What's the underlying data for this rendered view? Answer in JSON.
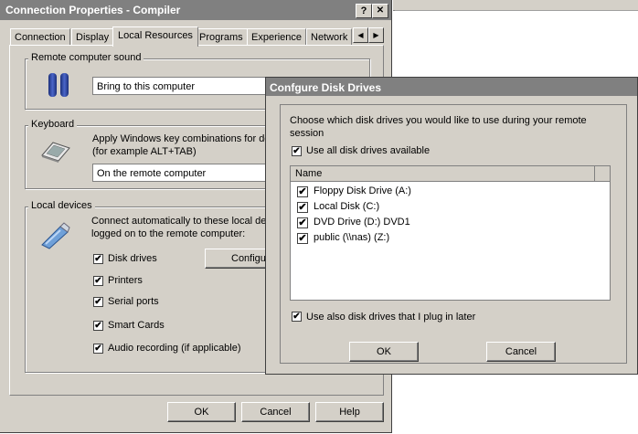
{
  "main_window": {
    "title": "Connection Properties - Compiler",
    "help_button": "?",
    "close_button": "✕",
    "tabs": [
      "Connection",
      "Display",
      "Local Resources",
      "Programs",
      "Experience",
      "Network"
    ],
    "active_tab": "Local Resources",
    "tab_scroll_left": "◀",
    "tab_scroll_right": "▶"
  },
  "remote_sound": {
    "label": "Remote computer sound",
    "value": "Bring to this computer"
  },
  "keyboard": {
    "label": "Keyboard",
    "desc_line1": "Apply Windows key combinations for de",
    "desc_line2": "(for example ALT+TAB)",
    "value": "On the remote computer"
  },
  "local_devices": {
    "label": "Local devices",
    "desc_line1": "Connect automatically to these local dev",
    "desc_line2": "logged on to the remote computer:",
    "configure_button": "Configu",
    "items": [
      {
        "label": "Disk drives",
        "checked": true
      },
      {
        "label": "Printers",
        "checked": true
      },
      {
        "label": "Serial ports",
        "checked": true
      },
      {
        "label": "Smart Cards",
        "checked": true
      },
      {
        "label": "Audio recording (if applicable)",
        "checked": true
      }
    ]
  },
  "main_buttons": {
    "ok": "OK",
    "cancel": "Cancel",
    "help": "Help"
  },
  "drives_dialog": {
    "title": "Confgure Disk Drives",
    "prompt_line1": "Choose which disk drives you would like to use during your remote",
    "prompt_line2": "session",
    "use_all_label": "Use all disk drives available",
    "use_all_checked": true,
    "column_name": "Name",
    "drives": [
      {
        "label": "Floppy Disk Drive (A:)",
        "checked": true
      },
      {
        "label": "Local Disk (C:)",
        "checked": true
      },
      {
        "label": "DVD Drive (D:) DVD1",
        "checked": true
      },
      {
        "label": "public (\\\\nas) (Z:)",
        "checked": true
      }
    ],
    "plug_later_label": "Use also disk drives that I plug in later",
    "plug_later_checked": true,
    "ok": "OK",
    "cancel": "Cancel"
  },
  "check_mark": "✔"
}
